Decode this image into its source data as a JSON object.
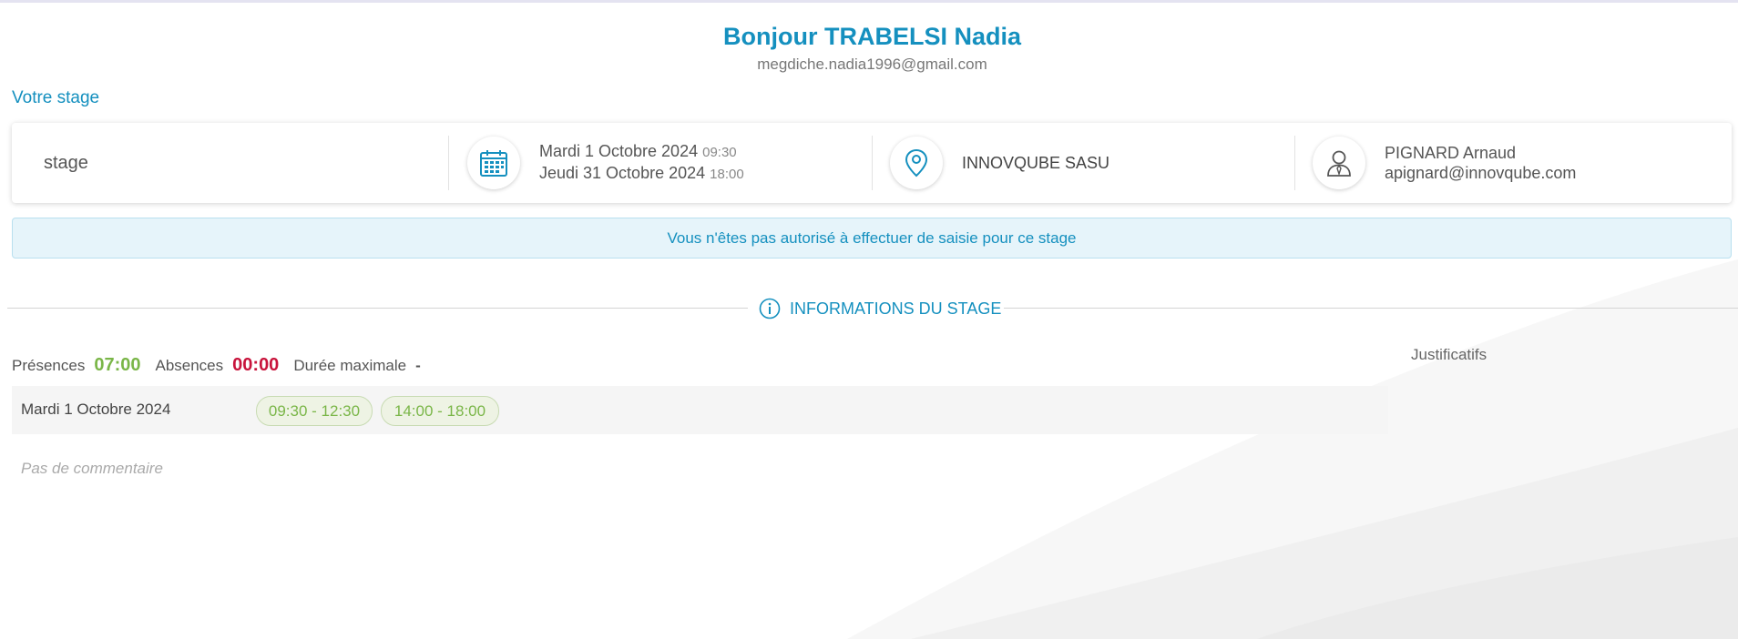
{
  "header": {
    "greeting": "Bonjour TRABELSI Nadia",
    "email": "megdiche.nadia1996@gmail.com"
  },
  "section": {
    "title": "Votre stage"
  },
  "stage_card": {
    "name": "stage",
    "start_date": "Mardi 1 Octobre 2024",
    "start_time": "09:30",
    "end_date": "Jeudi 31 Octobre 2024",
    "end_time": "18:00",
    "company": "INNOVQUBE SASU",
    "tutor_name": "PIGNARD Arnaud",
    "tutor_email": "apignard@innovqube.com",
    "icons": [
      "calendar-icon",
      "location-pin-icon",
      "person-icon"
    ]
  },
  "alert": {
    "message": "Vous n'êtes pas autorisé à effectuer de saisie pour ce stage"
  },
  "separator": {
    "label": "INFORMATIONS DU STAGE",
    "icon": "info-icon"
  },
  "stats": {
    "presences_label": "Présences",
    "presences_value": "07:00",
    "absences_label": "Absences",
    "absences_value": "00:00",
    "max_label": "Durée maximale",
    "max_value": "-"
  },
  "justificatifs": {
    "title": "Justificatifs"
  },
  "day": {
    "label": "Mardi 1 Octobre 2024",
    "slots": [
      "09:30 - 12:30",
      "14:00 - 18:00"
    ]
  },
  "comment": {
    "text": "Pas de commentaire"
  },
  "colors": {
    "accent": "#1590bf",
    "presence": "#7ab648",
    "absence": "#c8143c",
    "alert_bg": "#e6f4fa"
  }
}
